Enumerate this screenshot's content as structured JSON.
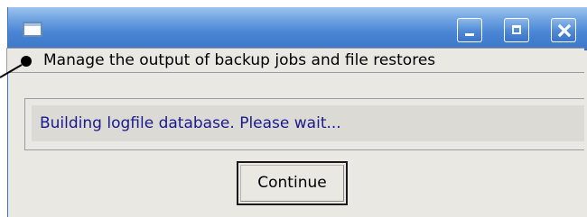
{
  "window": {
    "title": ""
  },
  "titlebar": {
    "minimize_icon": "minimize-icon",
    "maximize_icon": "maximize-icon",
    "close_icon": "close-icon",
    "accent_color": "#4a85d4"
  },
  "main": {
    "header_text": "Manage the output of backup jobs and file restores",
    "status_text": "Building logfile database. Please wait...",
    "status_color": "#1a1a8c",
    "continue_label": "Continue"
  }
}
